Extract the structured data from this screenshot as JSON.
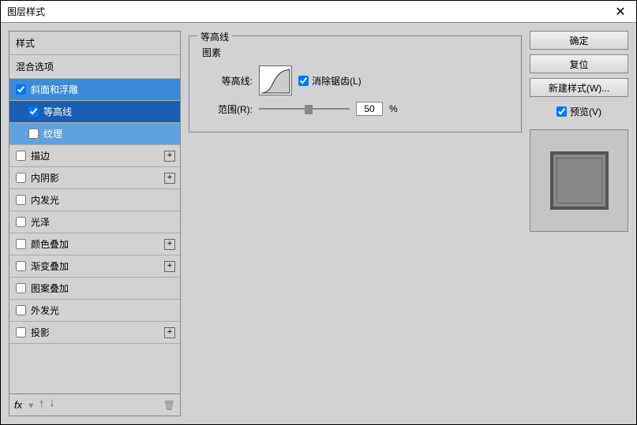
{
  "window": {
    "title": "图层样式"
  },
  "leftPanel": {
    "header1": "样式",
    "header2": "混合选项",
    "items": [
      {
        "label": "斜面和浮雕",
        "checked": true
      },
      {
        "label": "等高线",
        "checked": true
      },
      {
        "label": "纹理",
        "checked": false
      },
      {
        "label": "描边",
        "checked": false
      },
      {
        "label": "内阴影",
        "checked": false
      },
      {
        "label": "内发光",
        "checked": false
      },
      {
        "label": "光泽",
        "checked": false
      },
      {
        "label": "颜色叠加",
        "checked": false
      },
      {
        "label": "渐变叠加",
        "checked": false
      },
      {
        "label": "图案叠加",
        "checked": false
      },
      {
        "label": "外发光",
        "checked": false
      },
      {
        "label": "投影",
        "checked": false
      }
    ],
    "fx": "fx"
  },
  "middle": {
    "groupTitle": "等高线",
    "subTitle": "图素",
    "contourLabel": "等高线:",
    "antialiasLabel": "消除锯齿(L)",
    "rangeLabel": "范围(R):",
    "rangeValue": "50",
    "rangeUnit": "%"
  },
  "right": {
    "ok": "确定",
    "reset": "复位",
    "newStyle": "新建样式(W)...",
    "preview": "预览(V)"
  }
}
